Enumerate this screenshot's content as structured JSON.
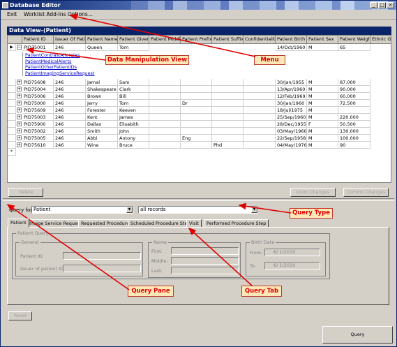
{
  "window": {
    "title": "Database Editor",
    "controls": [
      "_",
      "□",
      "×"
    ]
  },
  "menu": {
    "items": [
      "Exit",
      "Worklist Add-Ins Options..."
    ]
  },
  "data_view": {
    "header": "Data View-(Patient)",
    "columns": [
      "Patient ID",
      "Issuer Of Pati",
      "Patient Name",
      "Patient Given",
      "Patient Middl",
      "Patient Prefix",
      "Patient Suffix",
      "Confidentialit",
      "Patient Birth",
      "Patient Sex",
      "Patient Weigh",
      "Ethnic Gr"
    ],
    "expanded_row": {
      "id": "PID75001",
      "issuer": "246",
      "name": "Queen",
      "given": "Tom",
      "birth": "14/Oct/1960",
      "sex": "M",
      "weight": "65"
    },
    "child_links": [
      "PatientContrastAllergies",
      "PatientMedicalAlerts",
      "PatientOtherPatientIDs",
      "PatientImagingServiceRequest"
    ],
    "rows": [
      [
        "PID75608",
        "246",
        "Jamal",
        "Sam",
        "",
        "",
        "",
        "",
        "30/Jan/1955",
        "M",
        "87.000"
      ],
      [
        "PID75004",
        "246",
        "Shakespeare",
        "Clark",
        "",
        "",
        "",
        "",
        "13/Apr/1960",
        "M",
        "90.000"
      ],
      [
        "PID75006",
        "246",
        "Brown",
        "Bill",
        "",
        "",
        "",
        "",
        "12/Feb/1969",
        "M",
        "60.000"
      ],
      [
        "PID75000",
        "246",
        "Jerry",
        "Tom",
        "",
        "Dr",
        "",
        "",
        "30/Jan/1960",
        "M",
        "72.500"
      ],
      [
        "PID75609",
        "246",
        "Forester",
        "Keeven",
        "",
        "",
        "",
        "",
        "18/Jul/1975",
        "M",
        ""
      ],
      [
        "PID75003",
        "246",
        "Kent",
        "James",
        "",
        "",
        "",
        "",
        "25/Sep/1960",
        "M",
        "220.000"
      ],
      [
        "PID75900",
        "246",
        "Dallas",
        "Elisabith",
        "",
        "",
        "",
        "",
        "28/Dec/1955",
        "F",
        "50.500"
      ],
      [
        "PID75002",
        "246",
        "Smith",
        "John",
        "",
        "",
        "",
        "",
        "03/May/1960",
        "M",
        "130.000"
      ],
      [
        "PID75005",
        "246",
        "Abbi",
        "Antony",
        "",
        "Eng",
        "",
        "",
        "22/Sep/1958",
        "M",
        "100.000"
      ],
      [
        "PID75610",
        "246",
        "Wine",
        "Bruce",
        "",
        "",
        "Phd",
        "",
        "04/May/1970",
        "M",
        "90"
      ]
    ],
    "new_row_marker": "*"
  },
  "grid_buttons": {
    "delete": "Delete",
    "undo": "Undo Changes",
    "commit": "Commit Changes"
  },
  "query": {
    "for_label": "Query for:",
    "for_value": "Patient",
    "scope_value": "all records",
    "tabs": [
      "Patient",
      "Image Service Request",
      "Requested Procedure",
      "Scheduled Procedure Step",
      "Visit",
      "Performed Procedure Step"
    ],
    "active_tab": "Patient",
    "group_title": "Patient Query",
    "general_title": "General",
    "patient_id_label": "Patient ID:",
    "issuer_label": "Issuer of patient ID:",
    "name_title": "Name",
    "first_label": "First:",
    "middle_label": "Middle:",
    "last_label": "Last:",
    "birth_title": "Birth Date",
    "from_label": "From:",
    "to_label": "To:",
    "from_date": "6/ 1/2010",
    "to_date": "6/ 1/2010",
    "reset": "Reset",
    "query_button": "Query"
  },
  "annotations": {
    "data_manipulation": "Data Manipulation View",
    "menu": "Menu",
    "query_type": "Query Type",
    "query_pane": "Query Pane",
    "query_tab": "Query Tab",
    "color": "#e00000"
  }
}
